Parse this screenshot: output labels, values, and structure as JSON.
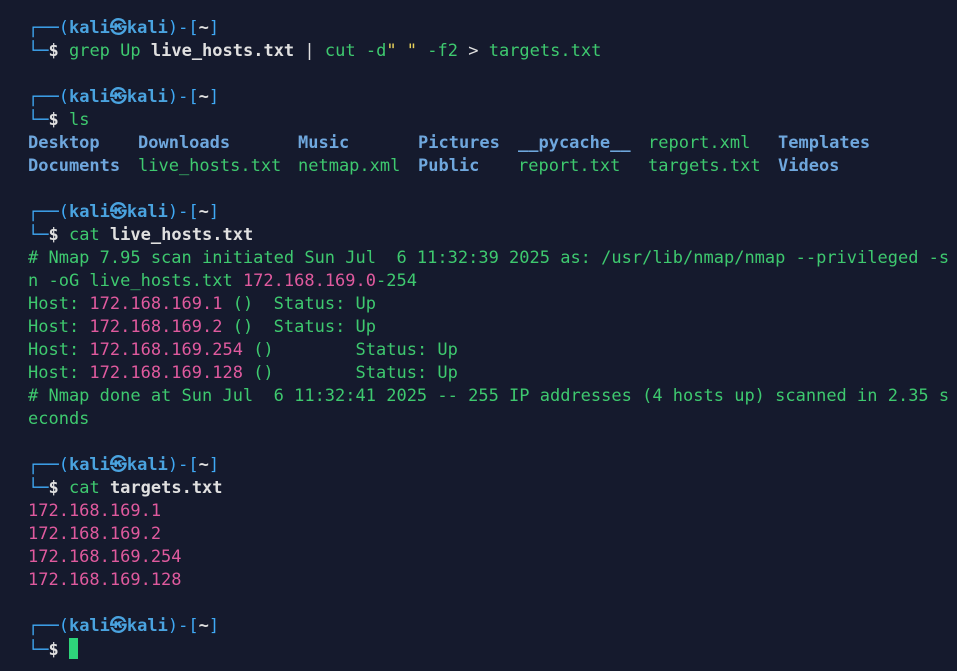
{
  "prompt": {
    "user": "kali",
    "at_symbol": "㉿",
    "host": "kali",
    "dir": "~",
    "frame_top_left": "┌──(",
    "frame_mid": ")-[",
    "frame_end": "]",
    "frame_bottom": "└─",
    "dollar": "$"
  },
  "commands": [
    {
      "cmd": "grep",
      "args": [
        {
          "text": " Up ",
          "class": "green"
        },
        {
          "text": "live_hosts.txt",
          "class": "file-b"
        },
        {
          "text": " | ",
          "class": "arg"
        },
        {
          "text": "cut",
          "class": "cmd"
        },
        {
          "text": " -d",
          "class": "green"
        },
        {
          "text": "\" \"",
          "class": "yellow"
        },
        {
          "text": " -f2 ",
          "class": "green"
        },
        {
          "text": "> ",
          "class": "arg"
        },
        {
          "text": "targets.txt",
          "class": "green"
        }
      ]
    },
    {
      "cmd": "ls"
    },
    {
      "cmd": "cat",
      "file": "live_hosts.txt"
    },
    {
      "cmd": "cat",
      "file": "targets.txt"
    }
  ],
  "ls_output": {
    "row1": [
      "Desktop",
      "Downloads",
      "Music",
      "Pictures",
      "__pycache__",
      "report.xml",
      "Templates"
    ],
    "row2": [
      "Documents",
      "live_hosts.txt",
      "netmap.xml",
      "Public",
      "report.txt",
      "targets.txt",
      "Videos"
    ]
  },
  "live_hosts": {
    "header_prefix": "# Nmap 7.95 scan initiated Sun Jul  6 11:32:39 2025 as: /usr/lib/nmap/nmap --privileged -s",
    "header_line2_prefix": "n -oG live_hosts.txt ",
    "header_range_ip": "172.168.169.0",
    "header_range_tail": "-254",
    "hosts": [
      {
        "label": "Host: ",
        "ip": "172.168.169.1",
        "rest": " ()  Status: Up"
      },
      {
        "label": "Host: ",
        "ip": "172.168.169.2",
        "rest": " ()  Status: Up"
      },
      {
        "label": "Host: ",
        "ip": "172.168.169.254",
        "rest": " ()        Status: Up"
      },
      {
        "label": "Host: ",
        "ip": "172.168.169.128",
        "rest": " ()        Status: Up"
      }
    ],
    "footer_line1": "# Nmap done at Sun Jul  6 11:32:41 2025 -- 255 IP addresses (4 hosts up) scanned in 2.35 s",
    "footer_line2": "econds"
  },
  "targets": [
    "172.168.169.1",
    "172.168.169.2",
    "172.168.169.254",
    "172.168.169.128"
  ]
}
